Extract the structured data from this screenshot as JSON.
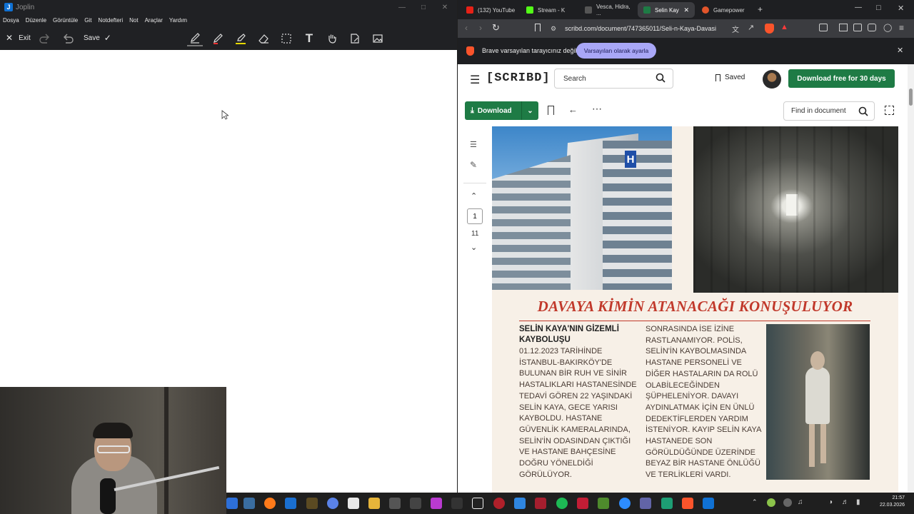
{
  "joplin": {
    "app_title": "Joplin",
    "menu": [
      "Dosya",
      "Düzenle",
      "Görüntüle",
      "Git",
      "Notdefteri",
      "Not",
      "Araçlar",
      "Yardım"
    ],
    "toolbar": {
      "exit_label": "Exit",
      "save_label": "Save"
    }
  },
  "browser": {
    "tabs": [
      {
        "label": "(132) YouTube",
        "color": "#e62117"
      },
      {
        "label": "Stream - K",
        "color": "#53fc18"
      },
      {
        "label": "Vesca, Hidra, ...",
        "color": "#2a2a2a"
      },
      {
        "label": "Selin Kay",
        "color": "#1e7b45"
      },
      {
        "label": "Gamepower",
        "color": "#e2552b"
      }
    ],
    "url": "scribd.com/document/747365011/Seli-n-Kaya-Davasi",
    "brave_notice": "Brave varsayılan tarayıcınız değil",
    "brave_button": "Varsayılan olarak ayarla"
  },
  "scribd": {
    "logo": "[SCRIBD]",
    "search_placeholder": "Search",
    "saved_label": "Saved",
    "download_free": "Download free for 30 days",
    "download_label": "Download",
    "find_placeholder": "Find in document",
    "page_current": "1",
    "page_total": "11",
    "accent": "#1e7b45"
  },
  "document": {
    "headline": "DAVAYA KİMİN ATANACAĞI KONUŞULUYOR",
    "article_title_1": "SELİN KAYA'NIN GİZEMLİ",
    "article_title_2": "KAYBOLUŞU",
    "col1_lines": [
      "01.12.2023 TARİHİNDE",
      "İSTANBUL-BAKIRKÖY'DE",
      "BULUNAN BİR RUH VE SİNİR",
      "HASTALIKLARI HASTANESİNDE",
      "TEDAVİ GÖREN 22 YAŞINDAKİ",
      "SELİN KAYA, GECE YARISI",
      "KAYBOLDU. HASTANE",
      "GÜVENLİK KAMERALARINDA,",
      "SELİN'İN ODASINDAN ÇIKTIĞI",
      "VE HASTANE BAHÇESİNE",
      "DOĞRU YÖNELDİĞİ",
      "GÖRÜLÜYOR."
    ],
    "col2_lines": [
      "SONRASINDA İSE İZİNE",
      "RASTLANAMIYOR. POLİS,",
      "SELİN'İN KAYBOLMASINDA",
      "HASTANE PERSONELİ VE",
      "DİĞER HASTALARIN DA ROLÜ",
      "OLABİLECEĞİNDEN",
      "ŞÜPHELENİYOR. DAVAYI",
      "AYDINLATMAK İÇİN EN ÜNLÜ",
      "DEDEKTİFLERDEN YARDIM",
      "İSTENİYOR. KAYIP SELİN KAYA",
      "HASTANEDE SON",
      "GÖRÜLDÜĞÜNDE ÜZERİNDE",
      "BEYAZ BİR HASTANE ÖNLÜĞÜ",
      "VE TERLİKLERİ VARDI."
    ],
    "headline_color": "#c1392b",
    "hospital_sign": "H"
  },
  "taskbar": {
    "time": "21:57",
    "date": "22.03.2026"
  }
}
